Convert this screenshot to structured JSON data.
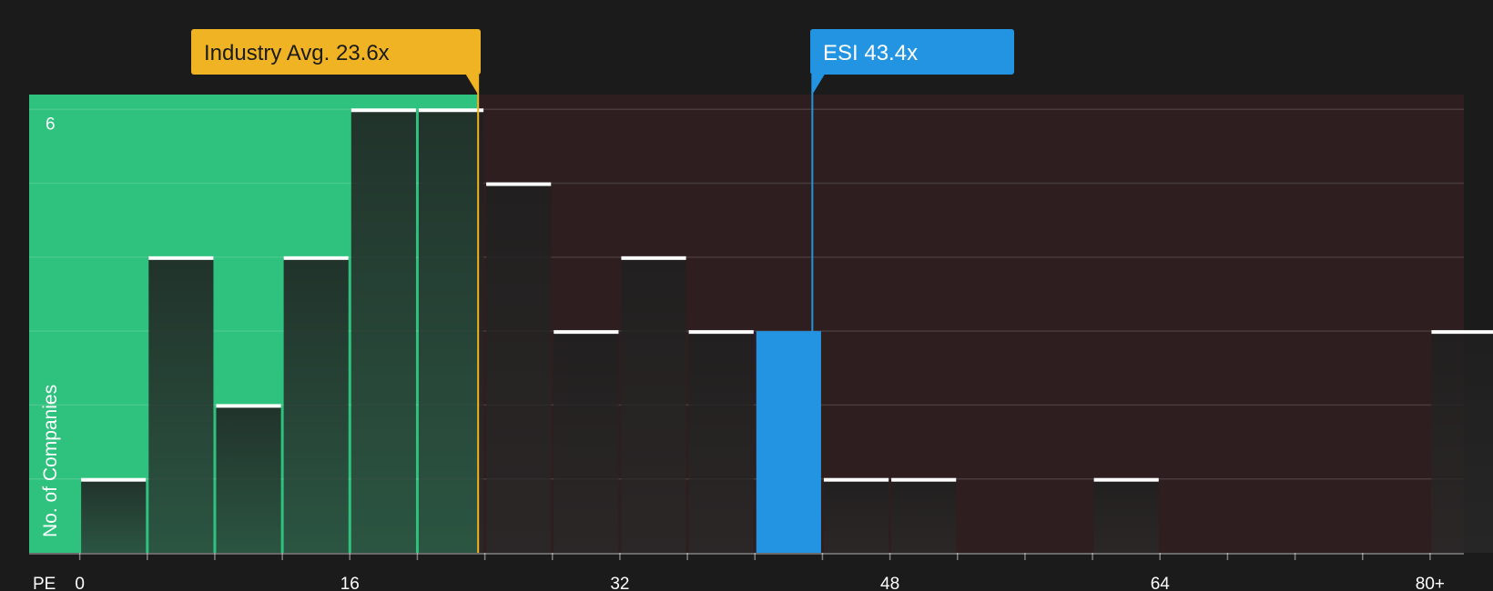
{
  "chart_data": {
    "type": "bar",
    "ylabel": "No. of Companies",
    "xlabel": "PE",
    "x_axis_ticks": [
      "0",
      "16",
      "32",
      "48",
      "64",
      "80+"
    ],
    "y_axis_ticks": [
      "6"
    ],
    "xlim": [
      -3,
      82
    ],
    "ylim": [
      0,
      6.2
    ],
    "bin_width": 4,
    "bins": [
      {
        "start": 0,
        "end": 4,
        "count": 1
      },
      {
        "start": 4,
        "end": 8,
        "count": 4
      },
      {
        "start": 8,
        "end": 12,
        "count": 2
      },
      {
        "start": 12,
        "end": 16,
        "count": 4
      },
      {
        "start": 16,
        "end": 20,
        "count": 6
      },
      {
        "start": 20,
        "end": 24,
        "count": 6
      },
      {
        "start": 24,
        "end": 28,
        "count": 5
      },
      {
        "start": 28,
        "end": 32,
        "count": 3
      },
      {
        "start": 32,
        "end": 36,
        "count": 4
      },
      {
        "start": 36,
        "end": 40,
        "count": 3
      },
      {
        "start": 40,
        "end": 44,
        "count": 3,
        "highlight": true
      },
      {
        "start": 44,
        "end": 48,
        "count": 1
      },
      {
        "start": 48,
        "end": 52,
        "count": 1
      },
      {
        "start": 60,
        "end": 64,
        "count": 1
      },
      {
        "start": 80,
        "end": 84,
        "count": 3
      }
    ],
    "markers": [
      {
        "label": "Industry Avg. 23.6x",
        "value": 23.6,
        "color": "#f0b323",
        "text_color": "#1b1b1b"
      },
      {
        "label": "ESI 43.4x",
        "value": 43.4,
        "color": "#2394e1",
        "text_color": "#ffffff"
      }
    ],
    "colors": {
      "background": "#1b1b1b",
      "below_avg_zone": "#2ec27e",
      "above_avg_zone": "#2e1e1f",
      "bar": "#222222",
      "highlight_bar": "#2394e1",
      "bar_top": "#ffffff"
    }
  }
}
